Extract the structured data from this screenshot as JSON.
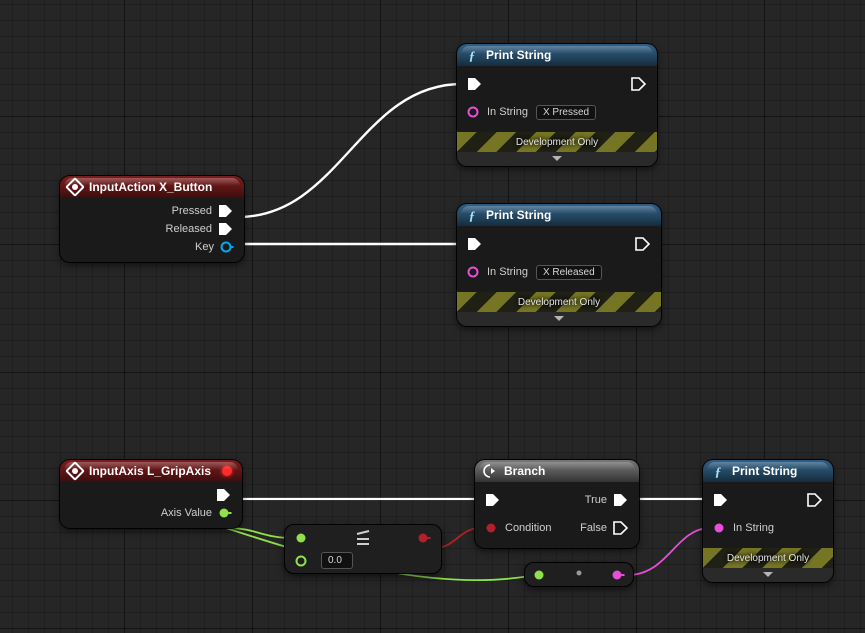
{
  "nodes": {
    "input_action": {
      "title": "InputAction X_Button",
      "pins": {
        "pressed": "Pressed",
        "released": "Released",
        "key": "Key"
      }
    },
    "print1": {
      "title": "Print String",
      "in_string_label": "In String",
      "in_string_value": "X Pressed",
      "dev_label": "Development Only"
    },
    "print2": {
      "title": "Print String",
      "in_string_label": "In String",
      "in_string_value": "X Released",
      "dev_label": "Development Only"
    },
    "input_axis": {
      "title": "InputAxis L_GripAxis",
      "pins": {
        "axis_value": "Axis Value"
      }
    },
    "compare": {
      "default_b": "0.0"
    },
    "branch": {
      "title": "Branch",
      "pins": {
        "condition": "Condition",
        "true": "True",
        "false": "False"
      }
    },
    "print3": {
      "title": "Print String",
      "in_string_label": "In String",
      "dev_label": "Development Only"
    }
  },
  "colors": {
    "exec": "#ffffff",
    "bool": "#b3202a",
    "float": "#8fe04b",
    "string": "#e84fd8",
    "key": "#00a8f3"
  }
}
